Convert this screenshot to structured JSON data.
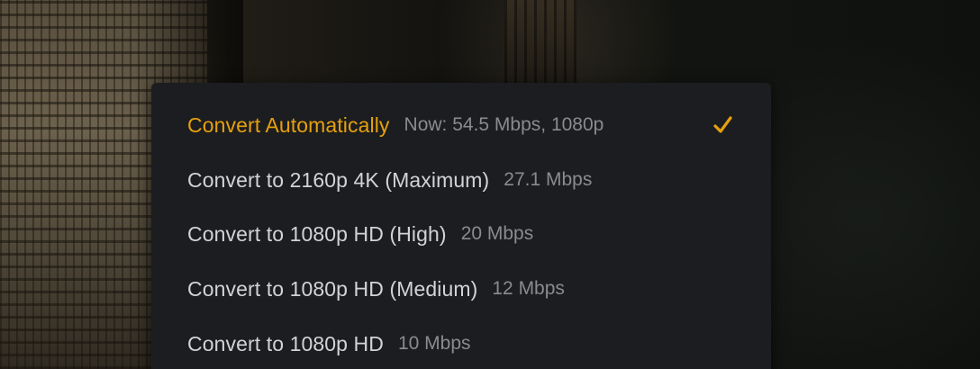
{
  "quality_menu": {
    "items": [
      {
        "label": "Convert Automatically",
        "detail": "Now: 54.5 Mbps, 1080p",
        "selected": true
      },
      {
        "label": "Convert to 2160p 4K (Maximum)",
        "detail": "27.1 Mbps",
        "selected": false
      },
      {
        "label": "Convert to 1080p HD (High)",
        "detail": "20 Mbps",
        "selected": false
      },
      {
        "label": "Convert to 1080p HD (Medium)",
        "detail": "12 Mbps",
        "selected": false
      },
      {
        "label": "Convert to 1080p HD",
        "detail": "10 Mbps",
        "selected": false
      }
    ],
    "selected_icon": "checkmark-icon"
  },
  "colors": {
    "accent": "#e5a00d",
    "menu_background": "#1c1d20",
    "label_text": "#d2d3d5",
    "detail_text": "#8a8b8e"
  }
}
